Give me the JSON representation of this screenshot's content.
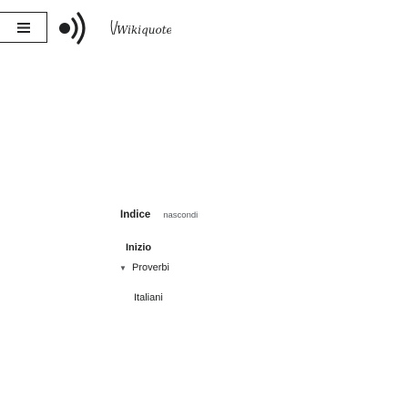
{
  "header": {
    "menu_icon": "hamburger-menu-icon",
    "logo_icon": "wikiquote-logo-icon",
    "wordmark": "Wikiquote"
  },
  "toc": {
    "title": "Indice",
    "hide_label": "nascondi",
    "items": [
      {
        "label": "Inizio",
        "level": 1
      },
      {
        "label": "Proverbi",
        "level": 1,
        "expanded": true,
        "icon": "chevron-down-icon"
      },
      {
        "label": "Italiani",
        "level": 2
      }
    ]
  }
}
